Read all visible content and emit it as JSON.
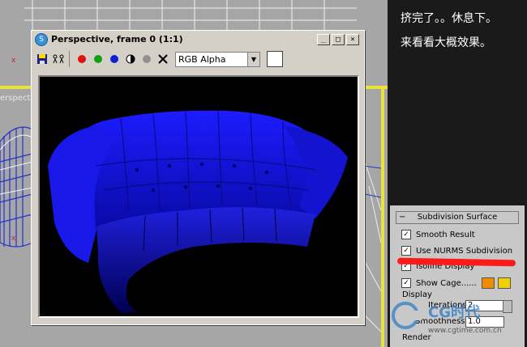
{
  "frame_window": {
    "title": "Perspective, frame 0 (1:1)",
    "channel_select": "RGB Alpha",
    "title_buttons": [
      "_",
      "□",
      "×"
    ]
  },
  "viewport": {
    "label": "erspective",
    "axis_label": "x"
  },
  "annotation": {
    "line1": "挤完了。。休息下。",
    "line2": "来看看大概效果。"
  },
  "subdivision_panel": {
    "title": "Subdivision Surface",
    "smooth_result": "Smooth Result",
    "use_nurms": "Use NURMS Subdivision",
    "isoline_display": "Isoline Display",
    "show_cage": "Show Cage......",
    "display_group": "Display",
    "iterations_label": "Iterations:",
    "iterations_value": "2",
    "smoothness_label": "Smoothness:",
    "smoothness_value": "1.0",
    "render_group": "Render",
    "cage_color_1": "#f08c00",
    "cage_color_2": "#f0d000"
  },
  "watermark": {
    "brand": "CG时代",
    "url": "www.cgtime.com.cn"
  },
  "colors": {
    "viewport_border": "#e9e23a",
    "sofa": "#1a1aff"
  }
}
